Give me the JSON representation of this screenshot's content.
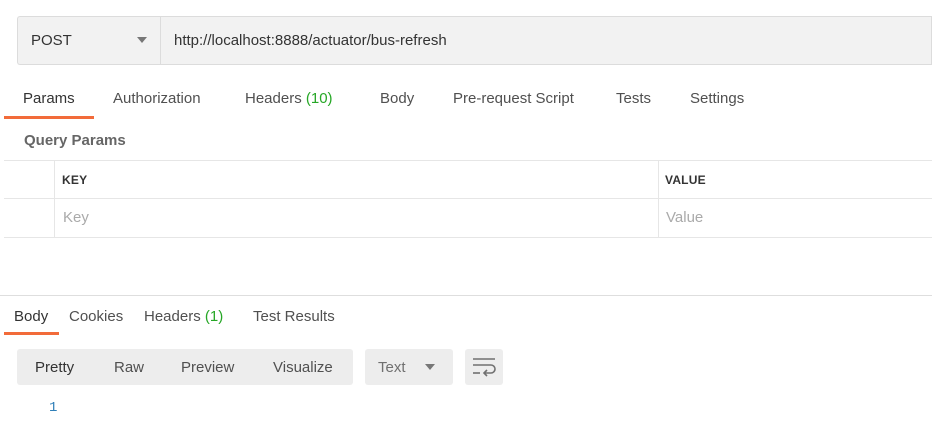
{
  "request": {
    "method": "POST",
    "url": "http://localhost:8888/actuator/bus-refresh"
  },
  "request_tabs": [
    {
      "label": "Params"
    },
    {
      "label": "Authorization"
    },
    {
      "label": "Headers",
      "count": "(10)"
    },
    {
      "label": "Body"
    },
    {
      "label": "Pre-request Script"
    },
    {
      "label": "Tests"
    },
    {
      "label": "Settings"
    }
  ],
  "query_params": {
    "title": "Query Params",
    "headers": {
      "key": "KEY",
      "value": "VALUE"
    },
    "placeholders": {
      "key": "Key",
      "value": "Value"
    }
  },
  "response_tabs": [
    {
      "label": "Body"
    },
    {
      "label": "Cookies"
    },
    {
      "label": "Headers",
      "count": "(1)"
    },
    {
      "label": "Test Results"
    }
  ],
  "view_modes": [
    "Pretty",
    "Raw",
    "Preview",
    "Visualize"
  ],
  "format": "Text",
  "response_body": {
    "line_number": "1"
  },
  "colors": {
    "accent": "#f26b3a",
    "count_green": "#26a726",
    "line_number": "#2f7fb8"
  }
}
